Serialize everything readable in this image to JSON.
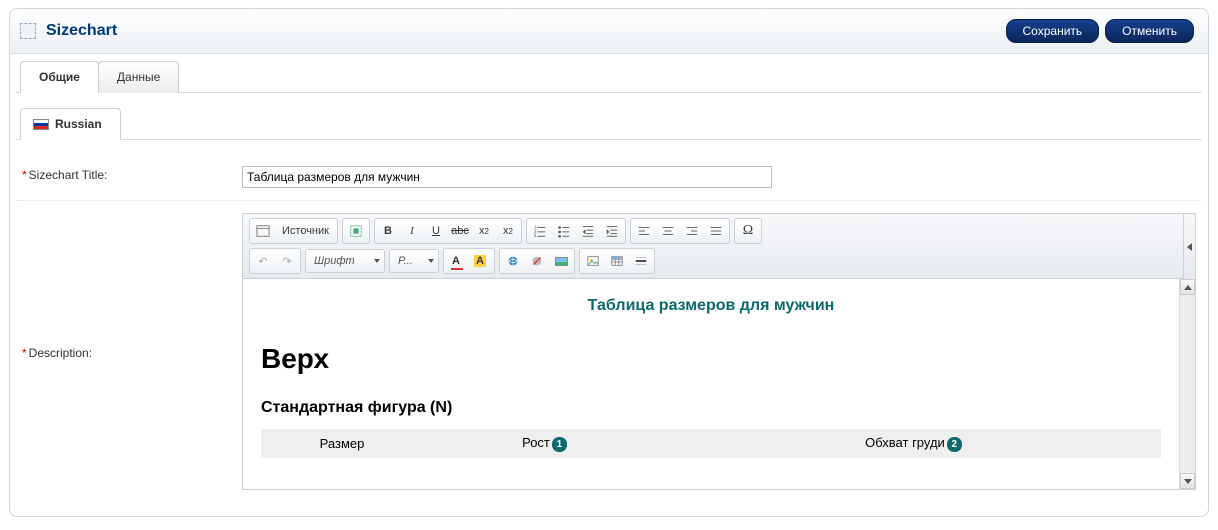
{
  "header": {
    "title": "Sizechart",
    "save_label": "Сохранить",
    "cancel_label": "Отменить"
  },
  "tabs": {
    "main": [
      {
        "label": "Общие",
        "active": true
      },
      {
        "label": "Данные",
        "active": false
      }
    ],
    "lang": {
      "label": "Russian"
    }
  },
  "form": {
    "title_label": "Sizechart Title:",
    "title_value": "Таблица размеров для мужчин",
    "description_label": "Description:"
  },
  "toolbar": {
    "source_label": "Источник",
    "font_label": "Шрифт",
    "size_label": "Р..."
  },
  "editor": {
    "doc_title": "Таблица размеров для мужчин",
    "h1": "Верх",
    "h2": "Стандартная фигура (N)",
    "table": {
      "headers": [
        {
          "text": "Размер",
          "badge": null
        },
        {
          "text": "Рост",
          "badge": "1"
        },
        {
          "text": "Обхват груди",
          "badge": "2"
        }
      ]
    }
  }
}
